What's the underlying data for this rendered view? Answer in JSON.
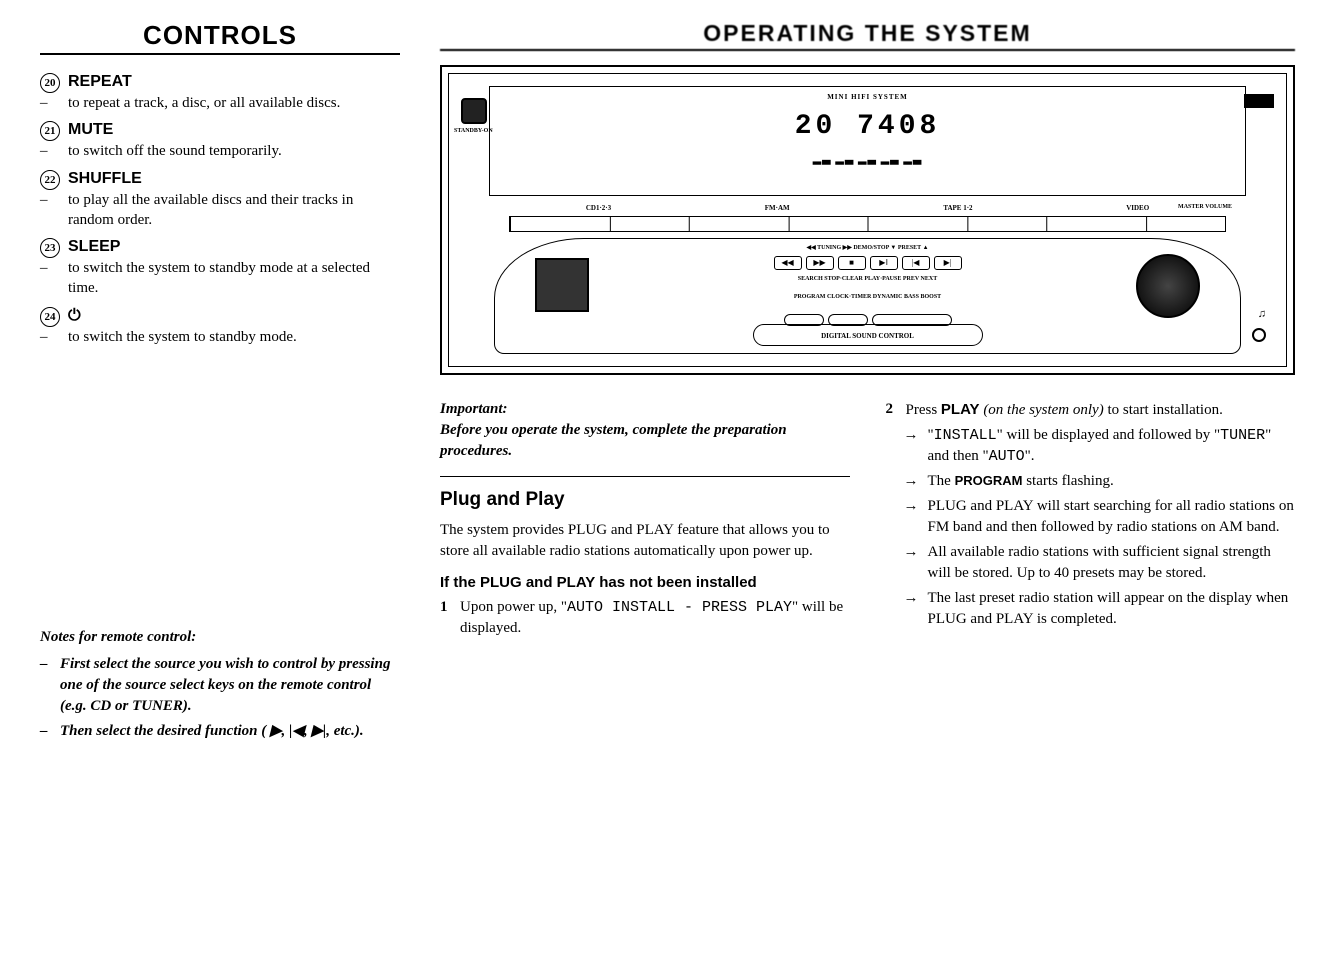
{
  "leftTitle": "CONTROLS",
  "rightTitle": "OPERATING THE SYSTEM",
  "controls": [
    {
      "num": "20",
      "label": "REPEAT",
      "desc": "to repeat a track, a disc, or all available discs."
    },
    {
      "num": "21",
      "label": "MUTE",
      "desc": "to switch off the sound temporarily."
    },
    {
      "num": "22",
      "label": "SHUFFLE",
      "desc": "to play all the available discs and their tracks in random order."
    },
    {
      "num": "23",
      "label": "SLEEP",
      "desc": "to switch the system to standby mode at a selected time."
    },
    {
      "num": "24",
      "label": "⏻",
      "desc": "to switch the system to standby mode."
    }
  ],
  "notes": {
    "title": "Notes for remote control:",
    "items": [
      "First select the source you wish to control by pressing one of the source select keys on the remote control (e.g. CD or TUNER).",
      "Then select the desired function ( ▶, |◀, ▶|, etc.)."
    ]
  },
  "diagram": {
    "miniLabel": "MINI HIFI SYSTEM",
    "display": "20 7408",
    "bars": "▂▃ ▂▃ ▂▃ ▂▃ ▂▃",
    "standbyLabel": "STANDBY-ON",
    "sources": [
      "CD1·2·3",
      "FM·AM",
      "TAPE 1·2",
      "VIDEO"
    ],
    "masterVol": "MASTER VOLUME",
    "rowTop": "◀◀  TUNING  ▶▶     DEMO/STOP           ▼  PRESET  ▲",
    "btns1": [
      "◀◀",
      "▶▶",
      "■",
      "▶‖",
      "|◀",
      "▶|"
    ],
    "rowMid": "SEARCH    STOP·CLEAR  PLAY·PAUSE  PREV    NEXT",
    "rowBot": "PROGRAM    CLOCK·TIMER    DYNAMIC BASS BOOST",
    "dsc": "DIGITAL SOUND CONTROL",
    "hp": "♫"
  },
  "important": {
    "label": "Important:",
    "text": "Before you operate the system, complete the preparation procedures."
  },
  "plugHeading": "Plug and Play",
  "plugIntro": "The system provides PLUG and PLAY feature that allows you to store all available radio stations automatically upon power up.",
  "plugSub": "If the PLUG and PLAY has not been installed",
  "step1": {
    "num": "1",
    "text_a": "Upon power up, \"",
    "lcd": "AUTO INSTALL - PRESS PLAY",
    "text_b": "\" will be displayed."
  },
  "step2": {
    "num": "2",
    "text_a": "Press ",
    "bold": "PLAY",
    "text_b": " (on the system only)",
    "text_c": " to start installation."
  },
  "arrows": [
    {
      "a": "\"",
      "lcd1": "INSTALL",
      "b": "\" will be displayed and followed by \"",
      "lcd2": "TUNER",
      "c": "\" and then \"",
      "lcd3": "AUTO",
      "d": "\"."
    },
    {
      "plain_a": "The ",
      "sc": "PROGRAM",
      "plain_b": " starts flashing."
    },
    {
      "plain": "PLUG and PLAY will start searching for all radio stations on FM band and then followed by radio stations on AM band."
    },
    {
      "plain": "All available radio stations with sufficient signal strength will be stored. Up to 40 presets may be stored."
    },
    {
      "plain": "The last preset radio station will appear on the display when PLUG and PLAY is completed."
    }
  ]
}
